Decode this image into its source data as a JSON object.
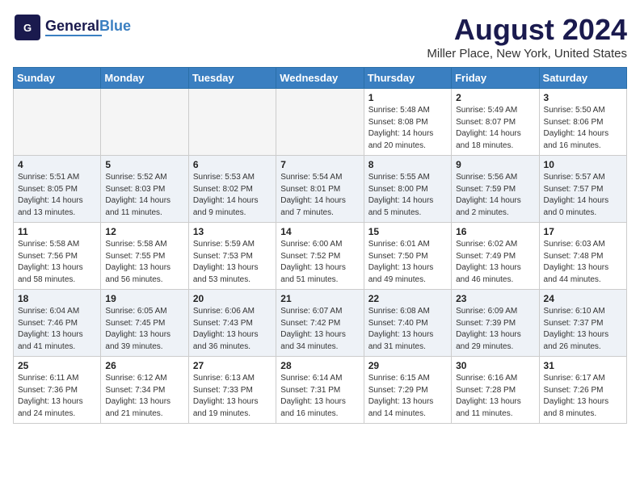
{
  "header": {
    "logo_line1": "General",
    "logo_line2": "Blue",
    "month_year": "August 2024",
    "location": "Miller Place, New York, United States"
  },
  "days_of_week": [
    "Sunday",
    "Monday",
    "Tuesday",
    "Wednesday",
    "Thursday",
    "Friday",
    "Saturday"
  ],
  "weeks": [
    [
      {
        "day": "",
        "info": ""
      },
      {
        "day": "",
        "info": ""
      },
      {
        "day": "",
        "info": ""
      },
      {
        "day": "",
        "info": ""
      },
      {
        "day": "1",
        "info": "Sunrise: 5:48 AM\nSunset: 8:08 PM\nDaylight: 14 hours\nand 20 minutes."
      },
      {
        "day": "2",
        "info": "Sunrise: 5:49 AM\nSunset: 8:07 PM\nDaylight: 14 hours\nand 18 minutes."
      },
      {
        "day": "3",
        "info": "Sunrise: 5:50 AM\nSunset: 8:06 PM\nDaylight: 14 hours\nand 16 minutes."
      }
    ],
    [
      {
        "day": "4",
        "info": "Sunrise: 5:51 AM\nSunset: 8:05 PM\nDaylight: 14 hours\nand 13 minutes."
      },
      {
        "day": "5",
        "info": "Sunrise: 5:52 AM\nSunset: 8:03 PM\nDaylight: 14 hours\nand 11 minutes."
      },
      {
        "day": "6",
        "info": "Sunrise: 5:53 AM\nSunset: 8:02 PM\nDaylight: 14 hours\nand 9 minutes."
      },
      {
        "day": "7",
        "info": "Sunrise: 5:54 AM\nSunset: 8:01 PM\nDaylight: 14 hours\nand 7 minutes."
      },
      {
        "day": "8",
        "info": "Sunrise: 5:55 AM\nSunset: 8:00 PM\nDaylight: 14 hours\nand 5 minutes."
      },
      {
        "day": "9",
        "info": "Sunrise: 5:56 AM\nSunset: 7:59 PM\nDaylight: 14 hours\nand 2 minutes."
      },
      {
        "day": "10",
        "info": "Sunrise: 5:57 AM\nSunset: 7:57 PM\nDaylight: 14 hours\nand 0 minutes."
      }
    ],
    [
      {
        "day": "11",
        "info": "Sunrise: 5:58 AM\nSunset: 7:56 PM\nDaylight: 13 hours\nand 58 minutes."
      },
      {
        "day": "12",
        "info": "Sunrise: 5:58 AM\nSunset: 7:55 PM\nDaylight: 13 hours\nand 56 minutes."
      },
      {
        "day": "13",
        "info": "Sunrise: 5:59 AM\nSunset: 7:53 PM\nDaylight: 13 hours\nand 53 minutes."
      },
      {
        "day": "14",
        "info": "Sunrise: 6:00 AM\nSunset: 7:52 PM\nDaylight: 13 hours\nand 51 minutes."
      },
      {
        "day": "15",
        "info": "Sunrise: 6:01 AM\nSunset: 7:50 PM\nDaylight: 13 hours\nand 49 minutes."
      },
      {
        "day": "16",
        "info": "Sunrise: 6:02 AM\nSunset: 7:49 PM\nDaylight: 13 hours\nand 46 minutes."
      },
      {
        "day": "17",
        "info": "Sunrise: 6:03 AM\nSunset: 7:48 PM\nDaylight: 13 hours\nand 44 minutes."
      }
    ],
    [
      {
        "day": "18",
        "info": "Sunrise: 6:04 AM\nSunset: 7:46 PM\nDaylight: 13 hours\nand 41 minutes."
      },
      {
        "day": "19",
        "info": "Sunrise: 6:05 AM\nSunset: 7:45 PM\nDaylight: 13 hours\nand 39 minutes."
      },
      {
        "day": "20",
        "info": "Sunrise: 6:06 AM\nSunset: 7:43 PM\nDaylight: 13 hours\nand 36 minutes."
      },
      {
        "day": "21",
        "info": "Sunrise: 6:07 AM\nSunset: 7:42 PM\nDaylight: 13 hours\nand 34 minutes."
      },
      {
        "day": "22",
        "info": "Sunrise: 6:08 AM\nSunset: 7:40 PM\nDaylight: 13 hours\nand 31 minutes."
      },
      {
        "day": "23",
        "info": "Sunrise: 6:09 AM\nSunset: 7:39 PM\nDaylight: 13 hours\nand 29 minutes."
      },
      {
        "day": "24",
        "info": "Sunrise: 6:10 AM\nSunset: 7:37 PM\nDaylight: 13 hours\nand 26 minutes."
      }
    ],
    [
      {
        "day": "25",
        "info": "Sunrise: 6:11 AM\nSunset: 7:36 PM\nDaylight: 13 hours\nand 24 minutes."
      },
      {
        "day": "26",
        "info": "Sunrise: 6:12 AM\nSunset: 7:34 PM\nDaylight: 13 hours\nand 21 minutes."
      },
      {
        "day": "27",
        "info": "Sunrise: 6:13 AM\nSunset: 7:33 PM\nDaylight: 13 hours\nand 19 minutes."
      },
      {
        "day": "28",
        "info": "Sunrise: 6:14 AM\nSunset: 7:31 PM\nDaylight: 13 hours\nand 16 minutes."
      },
      {
        "day": "29",
        "info": "Sunrise: 6:15 AM\nSunset: 7:29 PM\nDaylight: 13 hours\nand 14 minutes."
      },
      {
        "day": "30",
        "info": "Sunrise: 6:16 AM\nSunset: 7:28 PM\nDaylight: 13 hours\nand 11 minutes."
      },
      {
        "day": "31",
        "info": "Sunrise: 6:17 AM\nSunset: 7:26 PM\nDaylight: 13 hours\nand 8 minutes."
      }
    ]
  ]
}
